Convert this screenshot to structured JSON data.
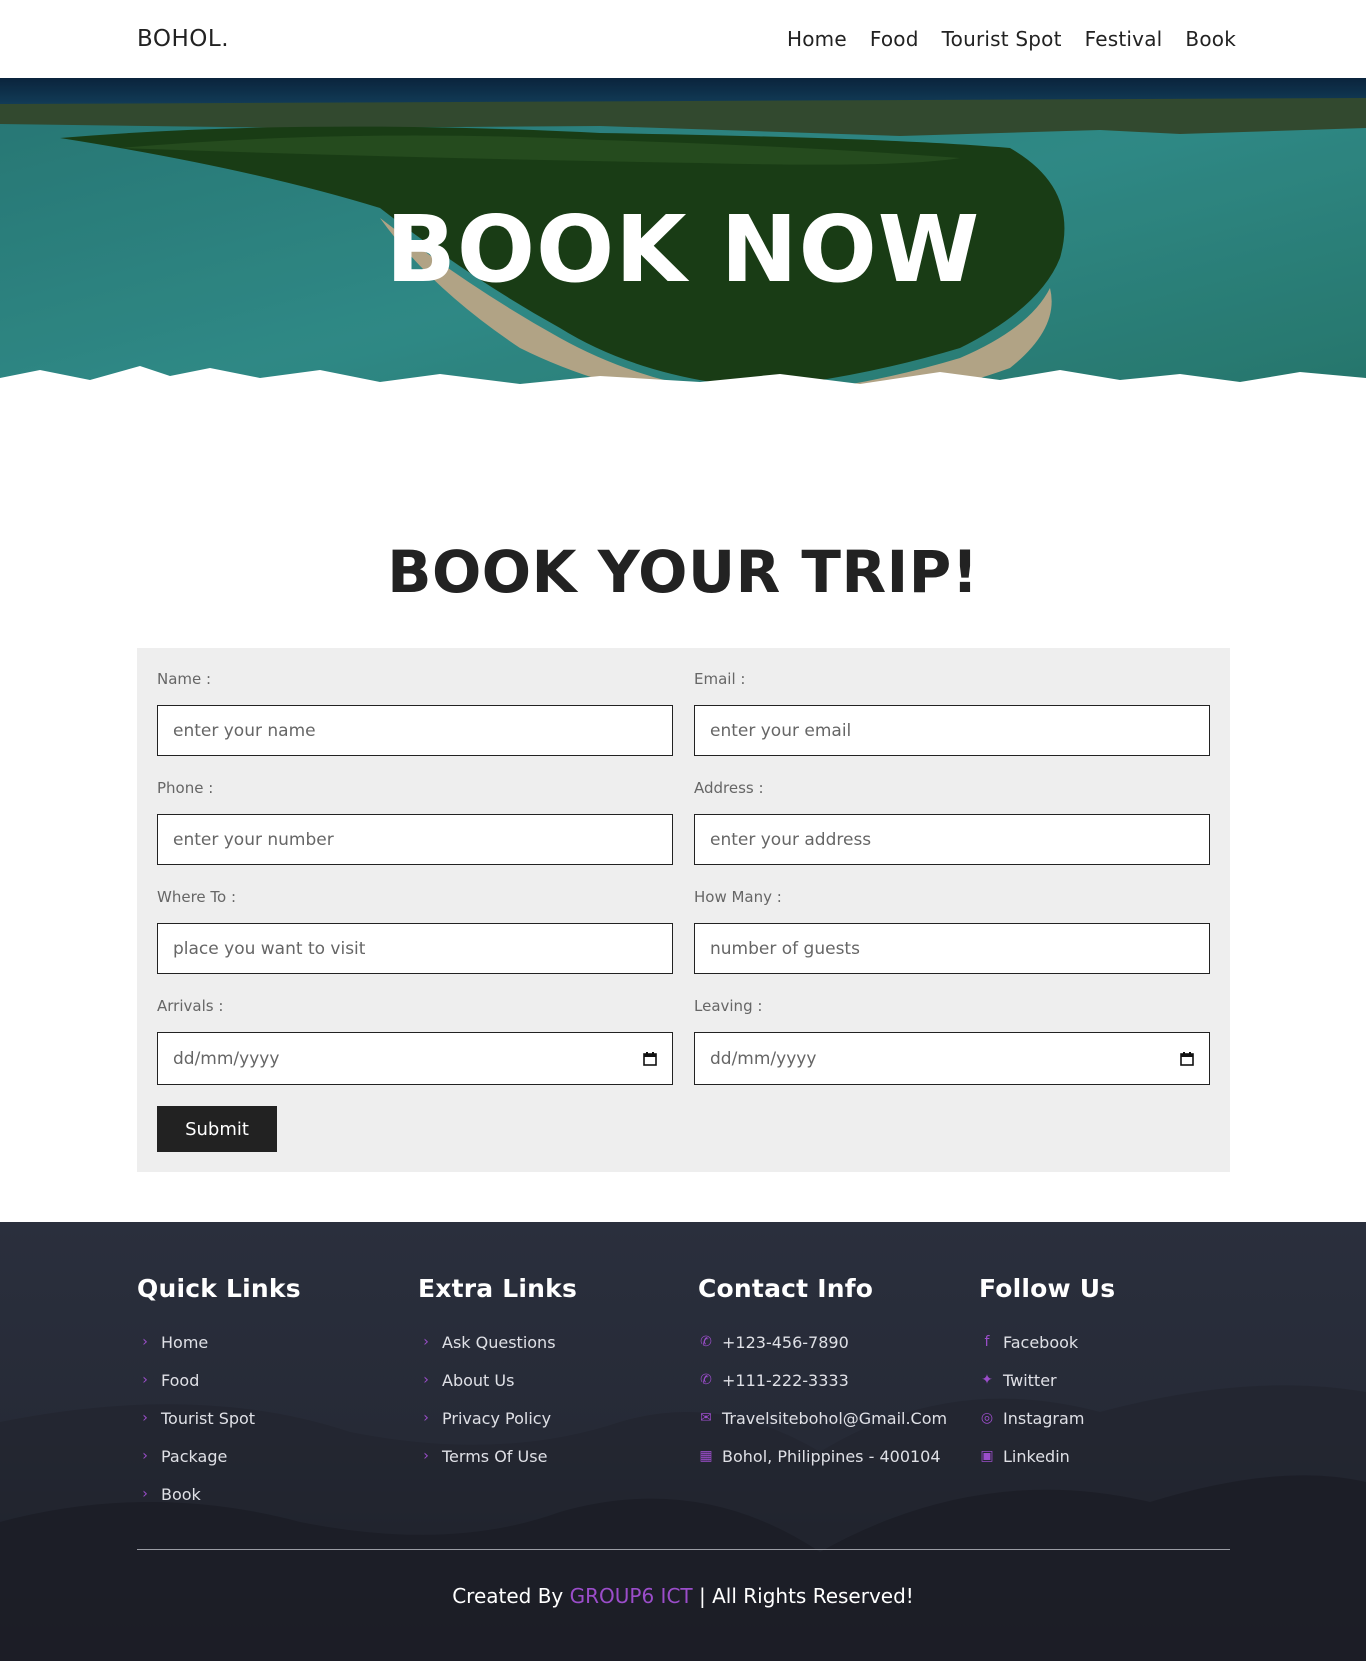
{
  "header": {
    "logo": "BOHOL.",
    "nav": [
      "Home",
      "Food",
      "Tourist Spot",
      "Festival",
      "Book"
    ]
  },
  "hero": {
    "title": "BOOK NOW"
  },
  "section": {
    "title": "BOOK YOUR TRIP!"
  },
  "form": {
    "fields": [
      {
        "label": "Name :",
        "placeholder": "enter your name"
      },
      {
        "label": "Email :",
        "placeholder": "enter your email"
      },
      {
        "label": "Phone :",
        "placeholder": "enter your number"
      },
      {
        "label": "Address :",
        "placeholder": "enter your address"
      },
      {
        "label": "Where To :",
        "placeholder": "place you want to visit"
      },
      {
        "label": "How Many :",
        "placeholder": "number of guests"
      },
      {
        "label": "Arrivals :",
        "placeholder": "dd/mm/yyyy"
      },
      {
        "label": "Leaving :",
        "placeholder": "dd/mm/yyyy"
      }
    ],
    "submit_label": "Submit"
  },
  "footer": {
    "quick_links": {
      "title": "Quick Links",
      "items": [
        "Home",
        "Food",
        "Tourist Spot",
        "Package",
        "Book"
      ]
    },
    "extra_links": {
      "title": "Extra Links",
      "items": [
        "Ask Questions",
        "About Us",
        "Privacy Policy",
        "Terms Of Use"
      ]
    },
    "contact_info": {
      "title": "Contact Info",
      "items": [
        "+123-456-7890",
        "+111-222-3333",
        "Travelsitebohol@Gmail.Com",
        "Bohol, Philippines - 400104"
      ]
    },
    "follow_us": {
      "title": "Follow Us",
      "items": [
        "Facebook",
        "Twitter",
        "Instagram",
        "Linkedin"
      ]
    },
    "credit_prefix": "Created By",
    "credit_author": "GROUP6 ICT",
    "credit_suffix": "| All Rights Reserved!",
    "accent_color": "#9b4dca"
  }
}
